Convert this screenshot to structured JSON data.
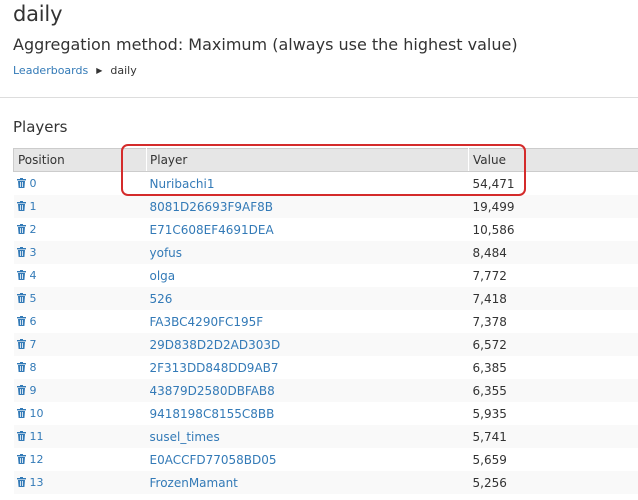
{
  "page": {
    "title": "daily",
    "subtitle": "Aggregation method: Maximum (always use the highest value)"
  },
  "breadcrumb": {
    "link": "Leaderboards",
    "current": "daily"
  },
  "section": {
    "title": "Players"
  },
  "table": {
    "headers": {
      "position": "Position",
      "player": "Player",
      "value": "Value"
    },
    "rows": [
      {
        "position": "0",
        "player": "Nuribachi1",
        "value": "54,471"
      },
      {
        "position": "1",
        "player": "8081D26693F9AF8B",
        "value": "19,499"
      },
      {
        "position": "2",
        "player": "E71C608EF4691DEA",
        "value": "10,586"
      },
      {
        "position": "3",
        "player": "yofus",
        "value": "8,484"
      },
      {
        "position": "4",
        "player": "olga",
        "value": "7,772"
      },
      {
        "position": "5",
        "player": "526",
        "value": "7,418"
      },
      {
        "position": "6",
        "player": "FA3BC4290FC195F",
        "value": "7,378"
      },
      {
        "position": "7",
        "player": "29D838D2D2AD303D",
        "value": "6,572"
      },
      {
        "position": "8",
        "player": "2F313DD848DD9AB7",
        "value": "6,385"
      },
      {
        "position": "9",
        "player": "43879D2580DBFAB8",
        "value": "6,355"
      },
      {
        "position": "10",
        "player": "9418198C8155C8BB",
        "value": "5,935"
      },
      {
        "position": "11",
        "player": "susel_times",
        "value": "5,741"
      },
      {
        "position": "12",
        "player": "E0ACCFD77058BD05",
        "value": "5,659"
      },
      {
        "position": "13",
        "player": "FrozenMamant",
        "value": "5,256"
      }
    ]
  },
  "icons": {
    "row_action": "trash-icon"
  },
  "colors": {
    "link": "#337ab7",
    "highlight": "#d42b2b",
    "header_bg": "#e6e6e6"
  }
}
